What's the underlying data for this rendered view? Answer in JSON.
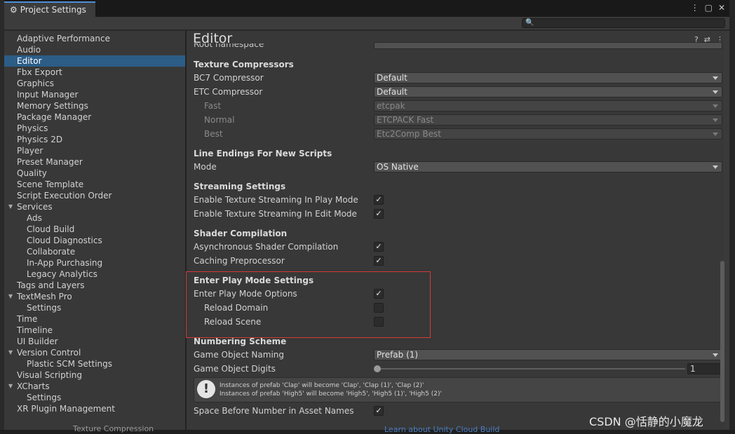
{
  "window": {
    "tab_title": "Project Settings",
    "controls": [
      "⋮",
      "▢",
      "✕"
    ],
    "search_placeholder": ""
  },
  "sidebar": {
    "items": [
      {
        "label": "Adaptive Performance",
        "indent": 0
      },
      {
        "label": "Audio",
        "indent": 0
      },
      {
        "label": "Editor",
        "indent": 0,
        "selected": true
      },
      {
        "label": "Fbx Export",
        "indent": 0
      },
      {
        "label": "Graphics",
        "indent": 0
      },
      {
        "label": "Input Manager",
        "indent": 0
      },
      {
        "label": "Memory Settings",
        "indent": 0
      },
      {
        "label": "Package Manager",
        "indent": 0
      },
      {
        "label": "Physics",
        "indent": 0
      },
      {
        "label": "Physics 2D",
        "indent": 0
      },
      {
        "label": "Player",
        "indent": 0
      },
      {
        "label": "Preset Manager",
        "indent": 0
      },
      {
        "label": "Quality",
        "indent": 0
      },
      {
        "label": "Scene Template",
        "indent": 0
      },
      {
        "label": "Script Execution Order",
        "indent": 0
      },
      {
        "label": "Services",
        "indent": 0,
        "expandable": true
      },
      {
        "label": "Ads",
        "indent": 1
      },
      {
        "label": "Cloud Build",
        "indent": 1
      },
      {
        "label": "Cloud Diagnostics",
        "indent": 1
      },
      {
        "label": "Collaborate",
        "indent": 1
      },
      {
        "label": "In-App Purchasing",
        "indent": 1
      },
      {
        "label": "Legacy Analytics",
        "indent": 1
      },
      {
        "label": "Tags and Layers",
        "indent": 0
      },
      {
        "label": "TextMesh Pro",
        "indent": 0,
        "expandable": true
      },
      {
        "label": "Settings",
        "indent": 1
      },
      {
        "label": "Time",
        "indent": 0
      },
      {
        "label": "Timeline",
        "indent": 0
      },
      {
        "label": "UI Builder",
        "indent": 0
      },
      {
        "label": "Version Control",
        "indent": 0,
        "expandable": true
      },
      {
        "label": "Plastic SCM Settings",
        "indent": 1
      },
      {
        "label": "Visual Scripting",
        "indent": 0
      },
      {
        "label": "XCharts",
        "indent": 0,
        "expandable": true
      },
      {
        "label": "Settings",
        "indent": 1
      },
      {
        "label": "XR Plugin Management",
        "indent": 0
      }
    ]
  },
  "main": {
    "title": "Editor",
    "clipped_label": "Root namespace",
    "texture_compressors": {
      "header": "Texture Compressors",
      "bc7_label": "BC7 Compressor",
      "bc7_value": "Default",
      "etc_label": "ETC Compressor",
      "etc_value": "Default",
      "fast_label": "Fast",
      "fast_value": "etcpak",
      "normal_label": "Normal",
      "normal_value": "ETCPACK Fast",
      "best_label": "Best",
      "best_value": "Etc2Comp Best"
    },
    "line_endings": {
      "header": "Line Endings For New Scripts",
      "mode_label": "Mode",
      "mode_value": "OS Native"
    },
    "streaming": {
      "header": "Streaming Settings",
      "play_label": "Enable Texture Streaming In Play Mode",
      "play_checked": true,
      "edit_label": "Enable Texture Streaming In Edit Mode",
      "edit_checked": true
    },
    "shader": {
      "header": "Shader Compilation",
      "async_label": "Asynchronous Shader Compilation",
      "async_checked": true,
      "cache_label": "Caching Preprocessor",
      "cache_checked": true
    },
    "play_mode": {
      "header": "Enter Play Mode Settings",
      "options_label": "Enter Play Mode Options",
      "options_checked": true,
      "domain_label": "Reload Domain",
      "domain_checked": false,
      "scene_label": "Reload Scene",
      "scene_checked": false
    },
    "numbering": {
      "header": "Numbering Scheme",
      "naming_label": "Game Object Naming",
      "naming_value": "Prefab (1)",
      "digits_label": "Game Object Digits",
      "digits_value": "1",
      "help_line1": "Instances of prefab 'Clap' will become 'Clap', 'Clap (1)', 'Clap (2)'",
      "help_line2": "Instances of prefab 'High5' will become 'High5', 'High5 (1)', 'High5 (2)'",
      "space_label": "Space Before Number in Asset Names",
      "space_checked": true
    }
  },
  "background": {
    "strip_left_text": "Texture Compression",
    "strip_link_text": "Learn about Unity Cloud Build"
  },
  "watermark": "CSDN @恬静的小魔龙"
}
